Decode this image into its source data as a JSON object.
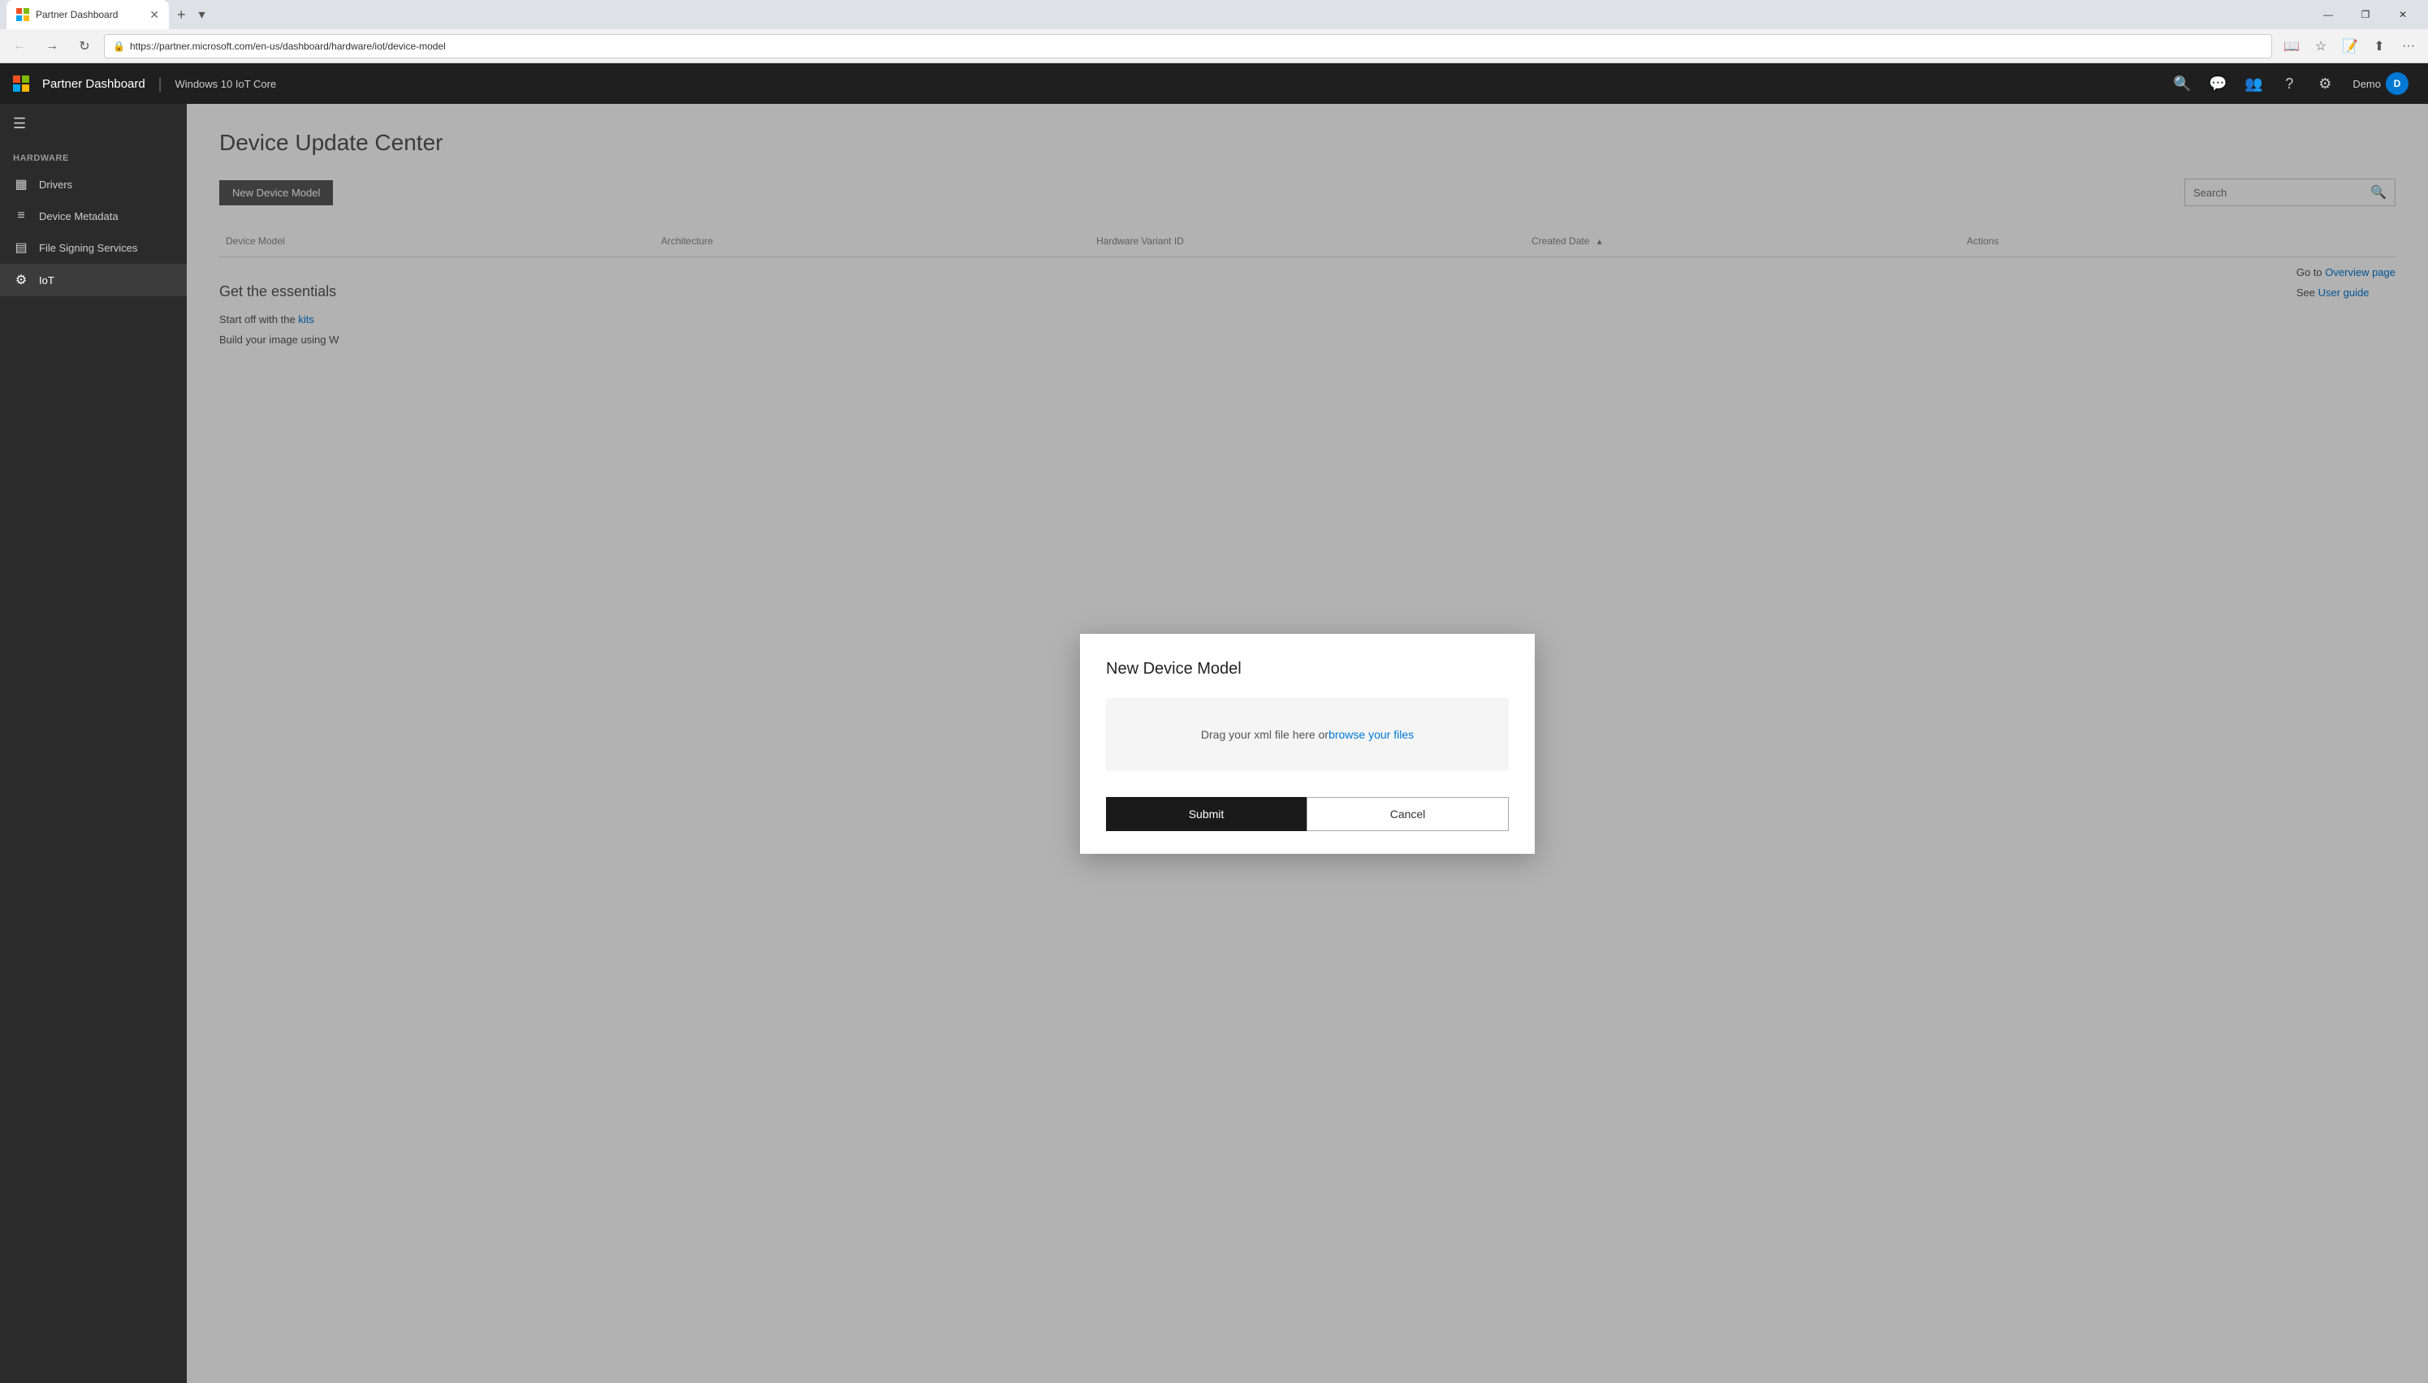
{
  "browser": {
    "tab_title": "Partner Dashboard",
    "tab_favicon": "🔷",
    "url": "https://partner.microsoft.com/en-us/dashboard/hardware/iot/device-model",
    "new_tab_label": "+",
    "win_minimize": "—",
    "win_restore": "❐",
    "win_close": "✕"
  },
  "app_header": {
    "title": "Partner Dashboard",
    "divider": "|",
    "subtitle": "Windows 10 IoT Core",
    "user_name": "Demo",
    "user_initial": "D"
  },
  "sidebar": {
    "section_title": "HARDWARE",
    "items": [
      {
        "label": "Drivers",
        "icon": "▦"
      },
      {
        "label": "Device Metadata",
        "icon": "≡"
      },
      {
        "label": "File Signing Services",
        "icon": "▤"
      },
      {
        "label": "IoT",
        "icon": "⚙"
      }
    ],
    "active_item": "IoT"
  },
  "page": {
    "title": "Device Update Center",
    "new_model_btn": "New Device Model",
    "search_placeholder": "Search",
    "table_columns": [
      "Device Model",
      "Architecture",
      "Hardware Variant ID",
      "Created Date",
      "Actions"
    ],
    "sort_col": "Created Date",
    "essentials_title": "Get the essentials",
    "essentials_line1_prefix": "Start off with the ",
    "essentials_line1_link": "kits",
    "essentials_line2_prefix": "Build your image using W",
    "side_links": [
      {
        "prefix": "Go to ",
        "link": "Overview page"
      },
      {
        "prefix": "See ",
        "link": "User guide"
      }
    ]
  },
  "modal": {
    "title": "New Device Model",
    "drop_zone_text": "Drag your xml file here or ",
    "drop_zone_link": "browse your files",
    "submit_label": "Submit",
    "cancel_label": "Cancel"
  }
}
